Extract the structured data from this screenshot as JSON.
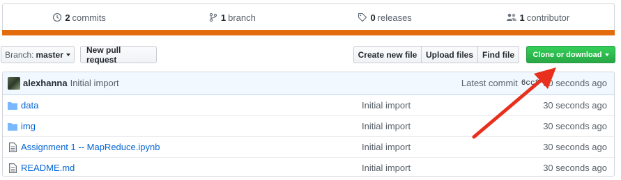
{
  "summary": {
    "commits": {
      "count": "2",
      "label": "commits",
      "icon": "history-icon"
    },
    "branches": {
      "count": "1",
      "label": "branch",
      "icon": "branch-icon"
    },
    "releases": {
      "count": "0",
      "label": "releases",
      "icon": "tag-icon"
    },
    "contributors": {
      "count": "1",
      "label": "contributor",
      "icon": "people-icon"
    },
    "language_bar_color": "#e36d0d"
  },
  "toolbar": {
    "branch_prefix": "Branch:",
    "branch_name": "master",
    "new_pull_request": "New pull request",
    "create_new_file": "Create new file",
    "upload_files": "Upload files",
    "find_file": "Find file",
    "clone_or_download": "Clone or download"
  },
  "commit": {
    "author": "alexhanna",
    "message": "Initial import",
    "latest_label": "Latest commit",
    "sha": "6cc8",
    "age": "30 seconds ago"
  },
  "files": [
    {
      "name": "data",
      "type": "folder",
      "message": "Initial import",
      "age": "30 seconds ago"
    },
    {
      "name": "img",
      "type": "folder",
      "message": "Initial import",
      "age": "30 seconds ago"
    },
    {
      "name": "Assignment 1 -- MapReduce.ipynb",
      "type": "file",
      "message": "Initial import",
      "age": "30 seconds ago"
    },
    {
      "name": "README.md",
      "type": "file",
      "message": "Initial import",
      "age": "30 seconds ago"
    }
  ],
  "colors": {
    "accent_green": "#28a745",
    "link_blue": "#0366d6",
    "arrow_red": "#e8301c"
  }
}
